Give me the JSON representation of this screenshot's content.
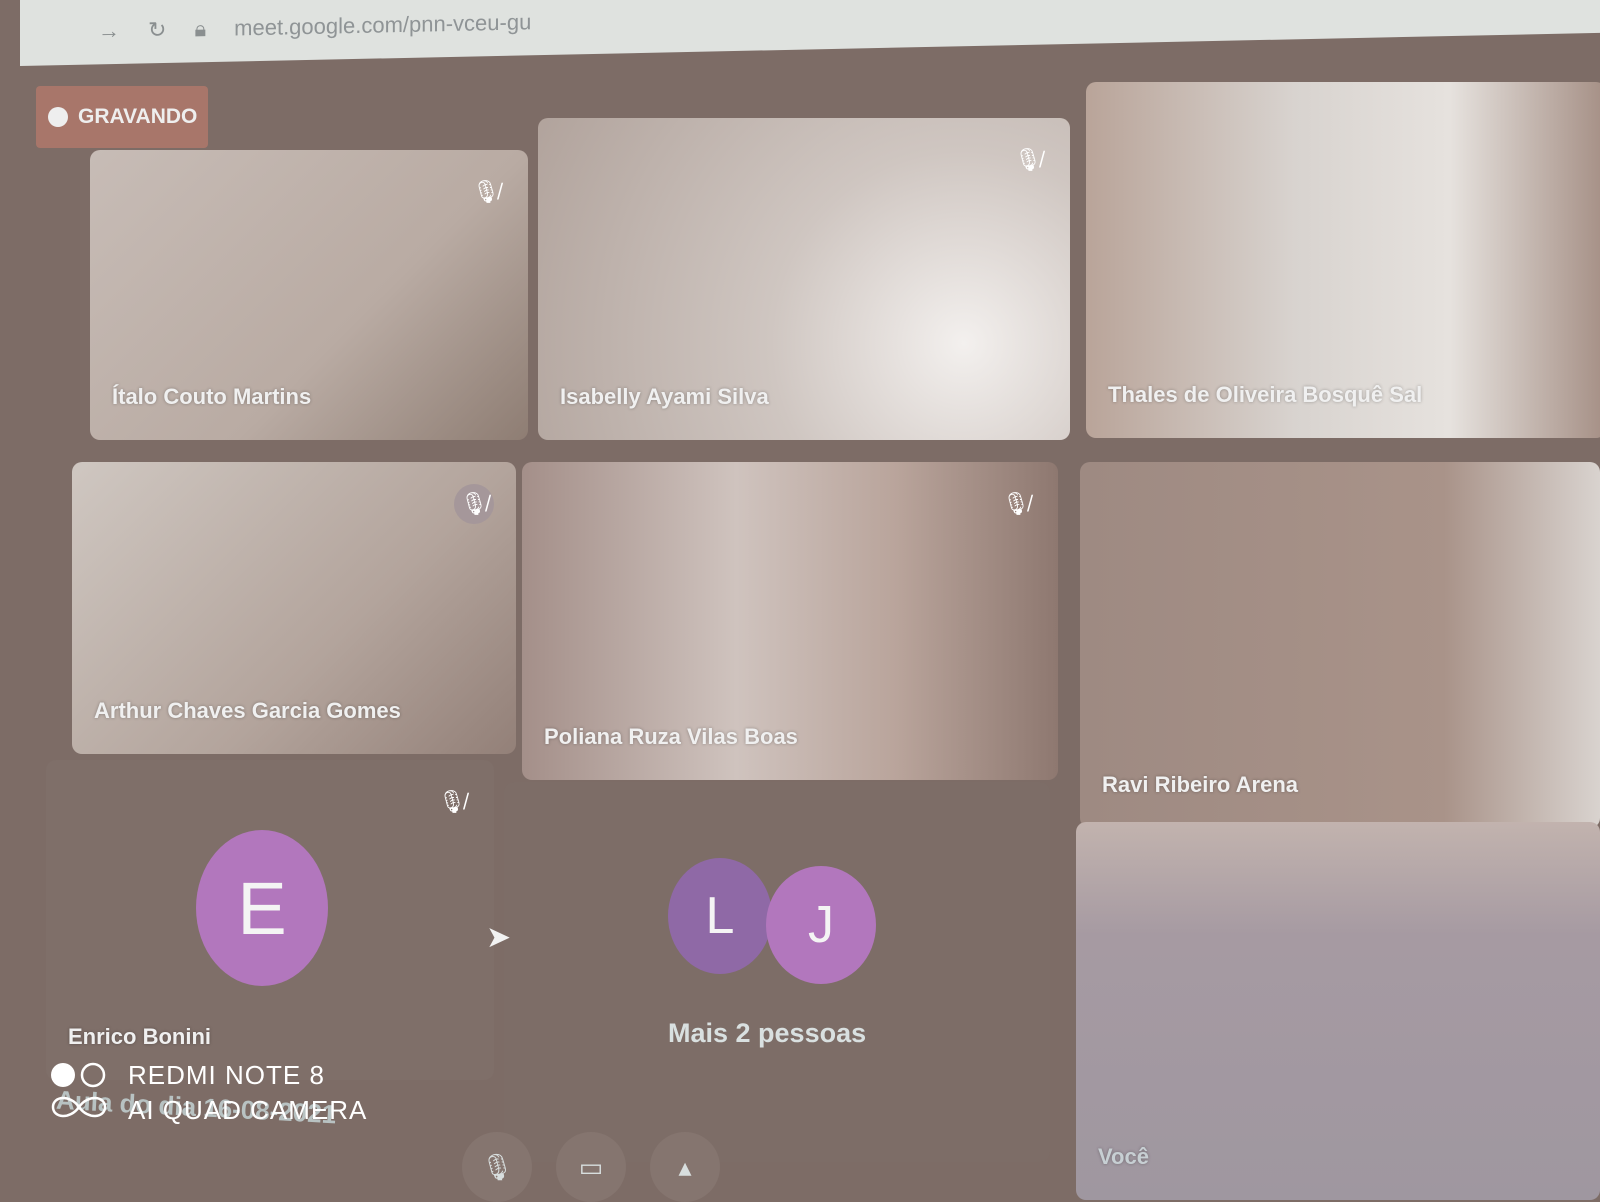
{
  "browser": {
    "url": "meet.google.com/pnn-vceu-gu",
    "forward_icon": "arrow-right-icon",
    "reload_icon": "reload-icon",
    "lock_icon": "lock-icon"
  },
  "recording": {
    "label": "GRAVANDO",
    "color": "#a8766a"
  },
  "participants": [
    {
      "name": "Ítalo Couto Martins",
      "muted": true
    },
    {
      "name": "Isabelly Ayami Silva",
      "muted": true
    },
    {
      "name": "Thales de Oliveira Bosquê Sal",
      "muted": false
    },
    {
      "name": "Arthur Chaves Garcia Gomes",
      "muted": true
    },
    {
      "name": "Poliana Ruza Vilas Boas",
      "muted": true
    },
    {
      "name": "Ravi Ribeiro Arena",
      "muted": false
    },
    {
      "name": "Enrico Bonini",
      "initial": "E",
      "muted": true
    },
    {
      "name": "Você",
      "muted": false
    }
  ],
  "more": {
    "label": "Mais 2 pessoas",
    "initials": [
      "L",
      "J"
    ]
  },
  "meeting_caption": "Aula do dia 16-08-2021",
  "watermark": {
    "line1": "REDMI NOTE 8",
    "line2": "AI QUAD CAMERA"
  },
  "avatar_color": "#b277bd"
}
